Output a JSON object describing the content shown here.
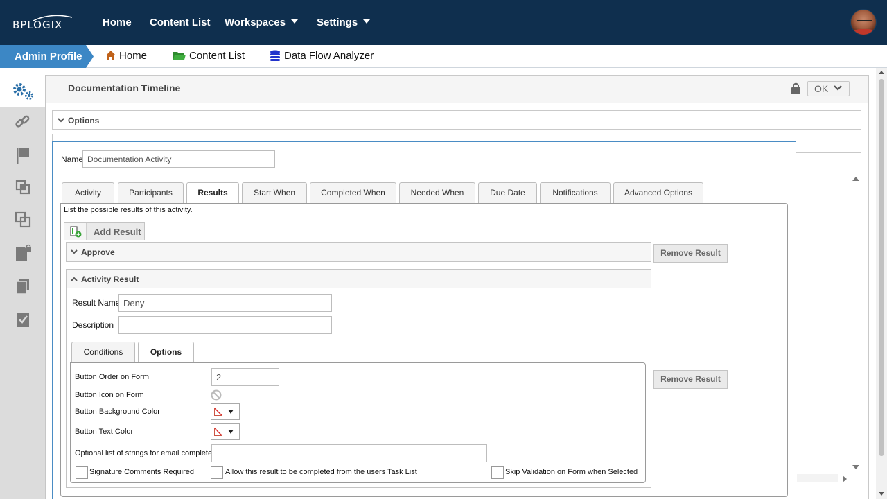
{
  "brand": {
    "logo_text": "BPLOGIX"
  },
  "topnav": {
    "items": [
      {
        "label": "Home"
      },
      {
        "label": "Content List"
      },
      {
        "label": "Workspaces"
      },
      {
        "label": "Settings"
      }
    ],
    "avatar_icon": "user-avatar"
  },
  "breadcrumb": {
    "profile": "Admin Profile",
    "items": [
      {
        "label": "Home",
        "icon": "home-icon",
        "color": "#c0621a"
      },
      {
        "label": "Content List",
        "icon": "folder-icon",
        "color": "#2e8b2e"
      },
      {
        "label": "Data Flow Analyzer",
        "icon": "database-icon",
        "color": "#2233cc"
      }
    ]
  },
  "sidebar": {
    "icons": [
      "gears-icon",
      "link-icon",
      "flag-icon",
      "nested-squares-icon",
      "overlap-squares-icon",
      "locked-document-icon",
      "copy-icon",
      "checked-document-icon"
    ]
  },
  "page": {
    "title": "Documentation Timeline",
    "ok_label": "OK",
    "options_label": "Options"
  },
  "dialog": {
    "name_label": "Name",
    "name_value": "Documentation Activity",
    "tabs": [
      {
        "label": "Activity"
      },
      {
        "label": "Participants"
      },
      {
        "label": "Results",
        "active": true
      },
      {
        "label": "Start When"
      },
      {
        "label": "Completed When"
      },
      {
        "label": "Needed When"
      },
      {
        "label": "Due Date"
      },
      {
        "label": "Notifications"
      },
      {
        "label": "Advanced Options"
      }
    ],
    "hint": "List the possible results of this activity.",
    "add_result_label": "Add Result",
    "results": [
      {
        "title": "Approve",
        "remove_label": "Remove Result"
      },
      {
        "title": "Activity Result",
        "remove_label": "Remove Result"
      }
    ],
    "result_form": {
      "result_name_label": "Result Name",
      "result_name_value": "Deny",
      "description_label": "Description",
      "description_value": "",
      "subtabs": [
        {
          "label": "Conditions"
        },
        {
          "label": "Options",
          "active": true
        }
      ],
      "options": {
        "button_order_label": "Button Order on Form",
        "button_order_value": "2",
        "button_icon_label": "Button Icon on Form",
        "bg_color_label": "Button Background Color",
        "text_color_label": "Button Text Color",
        "email_strings_label": "Optional list of strings for email complete",
        "email_strings_value": "",
        "checkboxes": [
          {
            "label": "Signature Comments Required",
            "checked": false
          },
          {
            "label": "Allow this result to be completed from the users Task List",
            "checked": false
          },
          {
            "label": "Skip Validation on Form when Selected",
            "checked": false
          }
        ]
      }
    }
  }
}
